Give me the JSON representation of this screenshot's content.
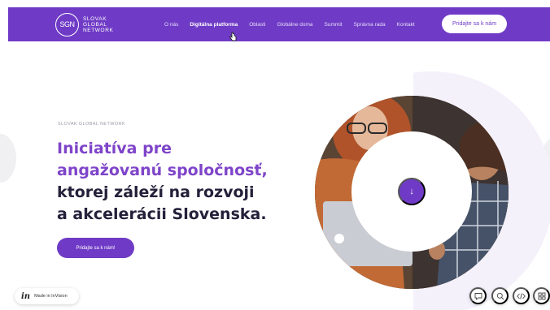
{
  "header": {
    "logo_mark": "SGN",
    "logo_lines": [
      "SLOVAK",
      "GLOBAL",
      "NETWORK"
    ],
    "nav_items": [
      "O nás",
      "Digitálna platforma",
      "Oblasti",
      "Globálne doma",
      "Summit",
      "Správna rada",
      "Kontakt"
    ],
    "active_index": 1,
    "cta_label": "Pridajte sa k nám"
  },
  "hero": {
    "eyebrow": "SLOVAK GLOBAL NETWORK",
    "headline_accent": [
      "Iniciatíva pre",
      "angažovanú spoločnosť,"
    ],
    "headline_dark": [
      "ktorej záleží na rozvoji",
      "a akcelerácii Slovenska."
    ],
    "cta_label": "Pridajte sa k nám!",
    "scroll_arrow": "↓"
  },
  "invision": {
    "logo": "in",
    "label": "Made in InVision"
  },
  "toolbar_icons": [
    "comment-icon",
    "search-icon",
    "code-icon",
    "grid-icon"
  ],
  "colors": {
    "brand": "#6f3bc6",
    "accent_text": "#7e44c9",
    "dark_text": "#25203a"
  }
}
